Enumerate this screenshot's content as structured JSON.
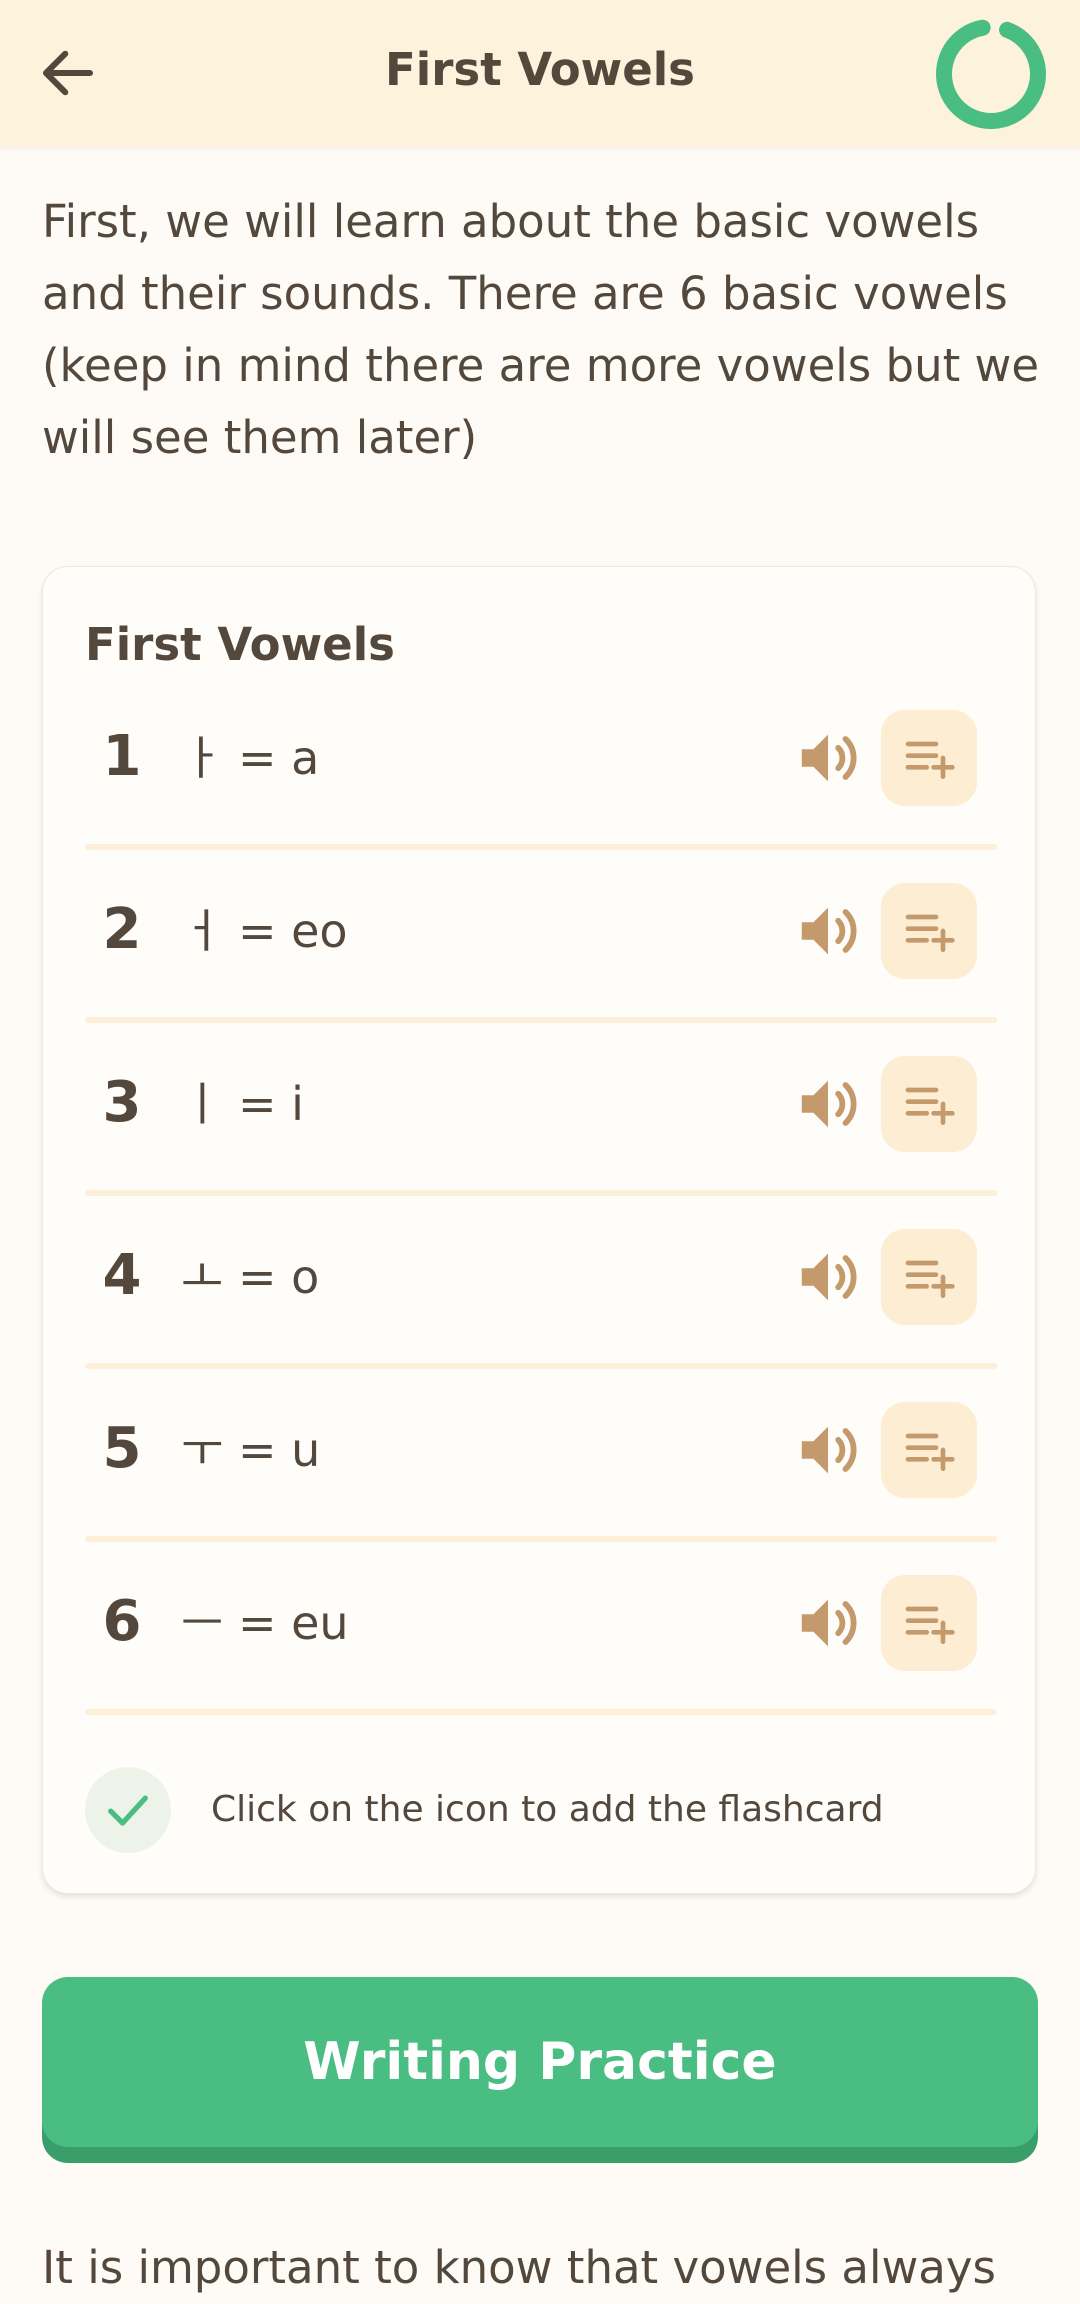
{
  "header": {
    "title": "First Vowels"
  },
  "intro_text": "First, we will learn about the basic vowels and their sounds. There are 6 basic vowels (keep in mind there are more vowels but we will see them later)",
  "card": {
    "title": "First Vowels",
    "items": [
      {
        "number": "1",
        "vowel": "ㅏ = a"
      },
      {
        "number": "2",
        "vowel": "ㅓ = eo"
      },
      {
        "number": "3",
        "vowel": "ㅣ = i"
      },
      {
        "number": "4",
        "vowel": "ㅗ = o"
      },
      {
        "number": "5",
        "vowel": "ㅜ = u"
      },
      {
        "number": "6",
        "vowel": "ㅡ = eu"
      }
    ],
    "hint": "Click on the icon to add the flashcard"
  },
  "writing_button_label": "Writing Practice",
  "bottom_text": "It is important to know that vowels always",
  "colors": {
    "header_bg": "#fdf2dc",
    "accent_green": "#49bd82",
    "icon_tan": "#c49a6c",
    "text_brown": "#54473b"
  },
  "icons": {
    "back": "arrow-left-icon",
    "progress": "progress-ring-icon",
    "sound": "speaker-icon",
    "add": "playlist-add-icon",
    "check": "check-icon"
  }
}
